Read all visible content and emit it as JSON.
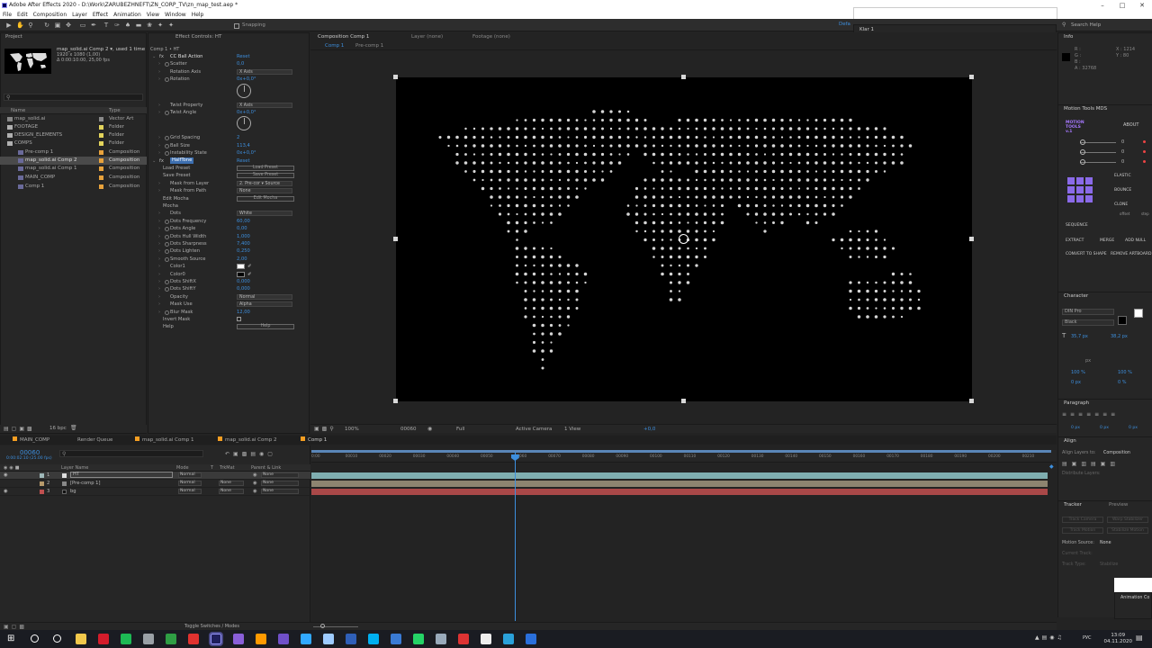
{
  "app": {
    "title": "Adobe After Effects 2020 - D:\\Work\\ZARUBEZHNEFT\\ZN_CORP_TV\\zn_map_test.aep *",
    "menu": [
      "File",
      "Edit",
      "Composition",
      "Layer",
      "Effect",
      "Animation",
      "View",
      "Window",
      "Help"
    ],
    "snapping": "Snapping",
    "workspace": "Defa",
    "klar": "Klar 1",
    "search_help": "Search Help"
  },
  "project": {
    "tab": "Project",
    "selected_name": "map_solid.ai Comp 2 ▾, used 1 time",
    "selected_res": "1920 x 1080 (1,00)",
    "selected_dur": "Δ 0:00:10:00, 25,00 fps",
    "col_name": "Name",
    "col_type": "Type",
    "items": [
      {
        "name": "map_solid.ai",
        "type": "Vector Art",
        "color": "#8a8a8a",
        "kind": "file"
      },
      {
        "name": "FOOTAGE",
        "type": "Folder",
        "color": "#e3d45c",
        "kind": "folder"
      },
      {
        "name": "DESIGN_ELEMENTS",
        "type": "Folder",
        "color": "#e3d45c",
        "kind": "folder"
      },
      {
        "name": "COMPS",
        "type": "Folder",
        "color": "#e3d45c",
        "kind": "folder"
      },
      {
        "name": "Pre-comp 1",
        "type": "Composition",
        "color": "#e8a23c",
        "kind": "comp"
      },
      {
        "name": "map_solid.ai Comp 2",
        "type": "Composition",
        "color": "#e8a23c",
        "kind": "comp",
        "selected": true
      },
      {
        "name": "map_solid.ai Comp 1",
        "type": "Composition",
        "color": "#e8a23c",
        "kind": "comp"
      },
      {
        "name": "MAIN_COMP",
        "type": "Composition",
        "color": "#e8a23c",
        "kind": "comp"
      },
      {
        "name": "Comp 1",
        "type": "Composition",
        "color": "#e8a23c",
        "kind": "comp"
      }
    ],
    "bpc": "16 bpc"
  },
  "effects": {
    "tab": "Effect Controls: HT",
    "path": "Comp 1 • HT",
    "rows": [
      {
        "label": "CC Ball Action",
        "value": "Reset",
        "kind": "fx"
      },
      {
        "label": "Scatter",
        "value": "0,0",
        "kind": "prop"
      },
      {
        "label": "Rotation Axis",
        "value": "X Axis",
        "kind": "select"
      },
      {
        "label": "Rotation",
        "value": "0x+0,0°",
        "kind": "prop"
      },
      {
        "label": "",
        "value": "",
        "kind": "dial"
      },
      {
        "label": "Twist Property",
        "value": "X Axis",
        "kind": "select"
      },
      {
        "label": "Twist Angle",
        "value": "0x+0,0°",
        "kind": "prop"
      },
      {
        "label": "",
        "value": "",
        "kind": "dial"
      },
      {
        "label": "Grid Spacing",
        "value": "2",
        "kind": "prop"
      },
      {
        "label": "Ball Size",
        "value": "113,4",
        "kind": "prop"
      },
      {
        "label": "Instability State",
        "value": "0x+0,0°",
        "kind": "prop"
      },
      {
        "label": "HalfTone",
        "value": "Reset",
        "kind": "fx2"
      },
      {
        "label": "Load Preset",
        "value": "Load Preset",
        "kind": "button"
      },
      {
        "label": "Save Preset",
        "value": "Save Preset",
        "kind": "button"
      },
      {
        "label": "Mask from Layer",
        "value": "2. Pre-cor ▾  Source",
        "kind": "select"
      },
      {
        "label": "Mask from Path",
        "value": "None",
        "kind": "select"
      },
      {
        "label": "Edit Mocha",
        "value": "Edit Mocha",
        "kind": "button"
      },
      {
        "label": "Mocha",
        "value": "",
        "kind": "group"
      },
      {
        "label": "Dots",
        "value": "White",
        "kind": "select"
      },
      {
        "label": "Dots Frequency",
        "value": "60,00",
        "kind": "prop"
      },
      {
        "label": "Dots Angle",
        "value": "0,00",
        "kind": "prop"
      },
      {
        "label": "Dots Hull Width",
        "value": "1,000",
        "kind": "prop"
      },
      {
        "label": "Dots Sharpness",
        "value": "7,400",
        "kind": "prop"
      },
      {
        "label": "Dots Lighten",
        "value": "0,250",
        "kind": "prop"
      },
      {
        "label": "Smooth Source",
        "value": "2,00",
        "kind": "prop"
      },
      {
        "label": "Color1",
        "value": "",
        "kind": "color"
      },
      {
        "label": "Color0",
        "value": "",
        "kind": "color0"
      },
      {
        "label": "Dots ShiftX",
        "value": "0,000",
        "kind": "prop"
      },
      {
        "label": "Dots ShiftY",
        "value": "0,000",
        "kind": "prop"
      },
      {
        "label": "Opacity",
        "value": "Normal",
        "kind": "select"
      },
      {
        "label": "Mask Use",
        "value": "Alpha",
        "kind": "select"
      },
      {
        "label": "Blur Mask",
        "value": "12,00",
        "kind": "prop"
      },
      {
        "label": "Invert Mask",
        "value": "",
        "kind": "check"
      },
      {
        "label": "Help",
        "value": "Help",
        "kind": "button"
      }
    ]
  },
  "composition": {
    "tab": "Composition Comp 1",
    "layer_tab": "Layer (none)",
    "footage_tab": "Footage (none)",
    "crumbs": [
      "Comp 1",
      "Pre-comp 1"
    ],
    "zoom": "100%",
    "timecode": "00060",
    "quality": "Full",
    "camera": "Active Camera",
    "view": "1 View",
    "exposure": "+0,0"
  },
  "right": {
    "info_tab": "Info",
    "info_rgb": [
      "R :",
      "G :",
      "B :",
      "A : 32768"
    ],
    "info_xy": [
      "X : 1214",
      "Y : 80"
    ],
    "motion_tab": "Motion Tools MDS",
    "motion_logo": "MOTION TOOLS v.1",
    "about": "ABOUT",
    "motion_vals": [
      "0",
      "0",
      "0"
    ],
    "motion_labels": {
      "elastic": "ELASTIC",
      "bounce": "BOUNCE",
      "clone": "CLONE",
      "offset": "offset",
      "step": "step",
      "sequence": "SEQUENCE",
      "extract": "EXTRACT",
      "merge": "MERGE",
      "addnull": "ADD NULL",
      "convert": "CONVERT TO SHAPE",
      "remove": "REMOVE ARTBOARD"
    },
    "character_tab": "Character",
    "font": "DIN Pro",
    "style": "Black",
    "size": "35,7 px",
    "leading": "38,2 px",
    "tracking_unit": "px",
    "scale_v": "100 %",
    "scale_h": "100 %",
    "baseline": "0 px",
    "tsume": "0 %",
    "paragraph_tab": "Paragraph",
    "para_vals": [
      "0 px",
      "0 px",
      "0 px",
      "0 px",
      "0 px"
    ],
    "align_tab": "Align",
    "align_to_label": "Align Layers to:",
    "align_to": "Composition",
    "distribute": "Distribute Layers:",
    "tracker_tab": "Tracker",
    "preview_tab": "Preview",
    "tracker_btns": [
      "Track Camera",
      "Warp Stabilizer",
      "Track Motion",
      "Stabilize Motion"
    ],
    "motion_source_label": "Motion Source:",
    "motion_source": "None",
    "current_track": "Current Track:",
    "track_type": "Track Type:",
    "track_type_val": "Stabilize",
    "animation_comp": "Animation Co"
  },
  "timeline": {
    "tabs": [
      "MAIN_COMP",
      "Render Queue",
      "map_solid.ai Comp 1",
      "map_solid.ai Comp 2",
      "Comp 1"
    ],
    "timecode": "00060",
    "timecode_sub": "0:00:02:10 (25.00 fps)",
    "headers": {
      "layer": "Layer Name",
      "mode": "Mode",
      "t": "T",
      "trkmat": "TrkMat",
      "parent": "Parent & Link"
    },
    "layers": [
      {
        "num": "1",
        "name": "HT",
        "mode": "Normal",
        "trk": "",
        "parent": "None",
        "color": "#9fb8b9",
        "bar": "#6e9b9c"
      },
      {
        "num": "2",
        "name": "[Pre-comp 1]",
        "mode": "Normal",
        "trk": "None",
        "parent": "None",
        "color": "#b79a6b",
        "bar": "#8c8068"
      },
      {
        "num": "3",
        "name": "bg",
        "mode": "Normal",
        "trk": "None",
        "parent": "None",
        "color": "#c05050",
        "bar": "#a84a4a"
      }
    ],
    "ticks": [
      "0:00",
      "00010",
      "00020",
      "00030",
      "00040",
      "00050",
      "00060",
      "00070",
      "00080",
      "00090",
      "00100",
      "00110",
      "00120",
      "00130",
      "00140",
      "00150",
      "00160",
      "00170",
      "00180",
      "00190",
      "00200",
      "00210"
    ],
    "toggle": "Toggle Switches / Modes",
    "playhead_frac": 0.2727
  },
  "taskbar": {
    "time": "13:09",
    "date": "04.11.2020",
    "lang": "РУС",
    "apps": [
      {
        "name": "search-icon",
        "color": "#ffffff"
      },
      {
        "name": "task-view-icon",
        "color": "#ffffff"
      },
      {
        "name": "file-explorer-icon",
        "color": "#f2c84b"
      },
      {
        "name": "opera-icon",
        "color": "#d41c2b"
      },
      {
        "name": "spotify-icon",
        "color": "#1db954"
      },
      {
        "name": "settings-icon",
        "color": "#9aa0a6"
      },
      {
        "name": "chrome-icon",
        "color": "#2f9e44"
      },
      {
        "name": "opera-gx-icon",
        "color": "#e0322f"
      },
      {
        "name": "after-effects-icon",
        "color": "#9999ff"
      },
      {
        "name": "premiere-icon",
        "color": "#8a5fd8"
      },
      {
        "name": "illustrator-icon",
        "color": "#ff9a00"
      },
      {
        "name": "app-purple-icon",
        "color": "#7050c8"
      },
      {
        "name": "photoshop-icon",
        "color": "#31a8ff"
      },
      {
        "name": "x-app-icon",
        "color": "#9ecbff"
      },
      {
        "name": "cinema4d-icon",
        "color": "#2f5fb8"
      },
      {
        "name": "skype-icon",
        "color": "#00aff0"
      },
      {
        "name": "app-blue-icon",
        "color": "#3a7bd5"
      },
      {
        "name": "whatsapp-icon",
        "color": "#25d366"
      },
      {
        "name": "steam-icon",
        "color": "#9ab"
      },
      {
        "name": "media-icon",
        "color": "#d33"
      },
      {
        "name": "uplay-icon",
        "color": "#eee"
      },
      {
        "name": "telegram-icon",
        "color": "#2aa1da"
      },
      {
        "name": "app-last-icon",
        "color": "#2a6fdb"
      }
    ]
  }
}
